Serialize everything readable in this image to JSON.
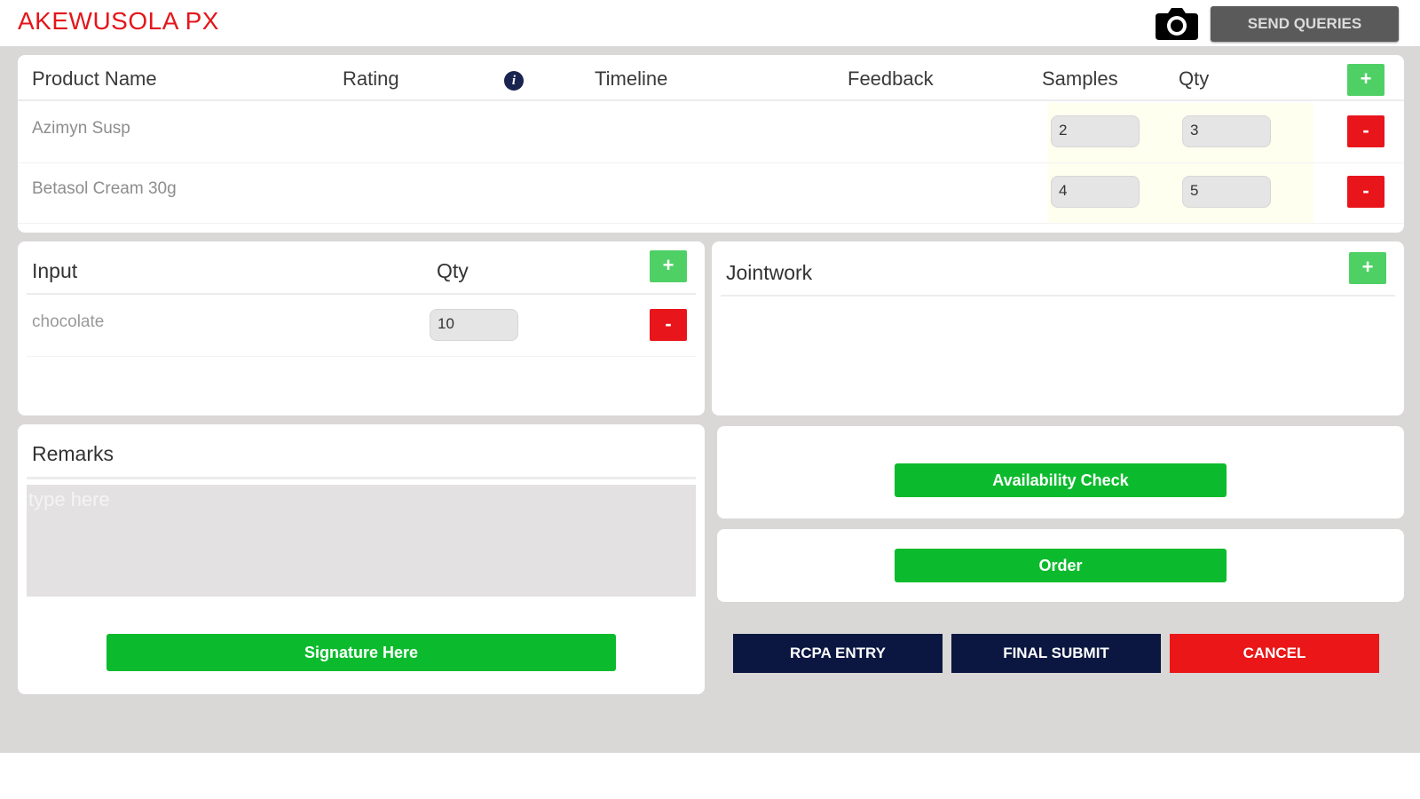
{
  "header": {
    "brand": "AKEWUSOLA PX",
    "send_queries": "SEND QUERIES",
    "camera_icon": "camera-icon"
  },
  "products": {
    "columns": [
      "Product Name",
      "Rating",
      "Timeline",
      "Feedback",
      "Samples",
      "Qty"
    ],
    "info_glyph": "i",
    "add_glyph": "+",
    "remove_glyph": "-",
    "rows": [
      {
        "name": "Azimyn Susp",
        "samples": "2",
        "qty": "3"
      },
      {
        "name": "Betasol Cream 30g",
        "samples": "4",
        "qty": "5"
      }
    ]
  },
  "input_section": {
    "col_input": "Input",
    "col_qty": "Qty",
    "add_glyph": "+",
    "remove_glyph": "-",
    "rows": [
      {
        "name": "chocolate",
        "qty": "10"
      }
    ]
  },
  "jointwork": {
    "title": "Jointwork",
    "add_glyph": "+"
  },
  "remarks": {
    "title": "Remarks",
    "placeholder": "type here",
    "signature_button": "Signature Here"
  },
  "actions": {
    "availability_check": "Availability Check",
    "order": "Order",
    "rcpa_entry": "RCPA ENTRY",
    "final_submit": "FINAL SUBMIT",
    "cancel": "CANCEL"
  },
  "colors": {
    "brand_red": "#e4161b",
    "green": "#0cbb2d",
    "light_green": "#4fd065",
    "navy": "#0b1741",
    "red": "#ea1617",
    "canvas_gray": "#dad7d7"
  }
}
